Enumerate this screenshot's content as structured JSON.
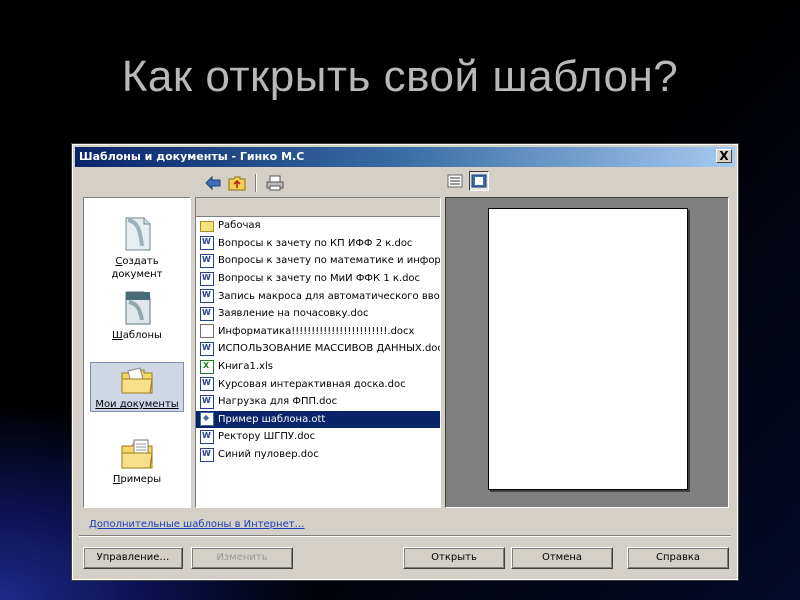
{
  "slide": {
    "title": "Как открыть свой шаблон?"
  },
  "dialog": {
    "title": "Шаблоны и документы - Гинко М.С",
    "close_label": "X"
  },
  "toolbar": {
    "icons": [
      "back-arrow-icon",
      "folder-up-icon",
      "print-icon",
      "list-view-icon",
      "preview-view-icon"
    ]
  },
  "categories": [
    {
      "label": "Создать документ",
      "accel": "С",
      "rest": "оздать",
      "line2": "документ",
      "icon": "new-document-icon"
    },
    {
      "label": "Шаблоны",
      "accel": "Ш",
      "rest": "аблоны",
      "icon": "templates-icon"
    },
    {
      "label": "Мои документы",
      "icon": "my-documents-folder-icon",
      "selected": true
    },
    {
      "label": "Примеры",
      "accel": "П",
      "rest": "римеры",
      "icon": "examples-icon"
    }
  ],
  "files": [
    {
      "name": "Рабочая",
      "type": "folder"
    },
    {
      "name": "Вопросы к зачету по КП ИФФ 2 к.doc",
      "type": "word"
    },
    {
      "name": "Вопросы к зачету по математике и инфор",
      "type": "word"
    },
    {
      "name": "Вопросы к зачету по МиИ ФФК 1 к.doc",
      "type": "word"
    },
    {
      "name": "Запись макроса для автоматического вво",
      "type": "word"
    },
    {
      "name": "Заявление на почасовку.doc",
      "type": "word"
    },
    {
      "name": "Информатика!!!!!!!!!!!!!!!!!!!!!!!!.docx",
      "type": "doc"
    },
    {
      "name": "ИСПОЛЬЗОВАНИЕ МАССИВОВ ДАННЫХ.doc",
      "type": "word"
    },
    {
      "name": "Книга1.xls",
      "type": "excel"
    },
    {
      "name": "Курсовая интерактивная доска.doc",
      "type": "word"
    },
    {
      "name": "Нагрузка для ФПП.doc",
      "type": "word"
    },
    {
      "name": "Пример шаблона.ott",
      "type": "template",
      "selected": true
    },
    {
      "name": "Ректору ШГПУ.doc",
      "type": "word"
    },
    {
      "name": "Синий пуловер.doc",
      "type": "word"
    }
  ],
  "more_templates_link": "Дополнительные шаблоны в Интернет…",
  "buttons": {
    "manage": "Управление…",
    "edit": "Изменить",
    "open": "Открыть",
    "cancel": "Отмена",
    "help": "Справка"
  }
}
